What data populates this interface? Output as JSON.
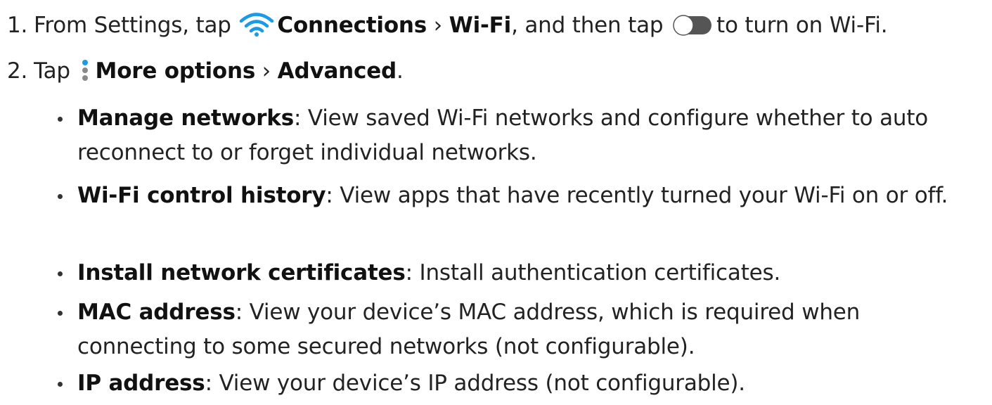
{
  "steps": [
    {
      "number": "1.",
      "part1": "From Settings, tap",
      "icon1": "wifi-icon",
      "bold1": "Connections",
      "sep1": " › ",
      "bold2": "Wi-Fi",
      "part2": ", and then tap",
      "icon2": "toggle-icon",
      "part3": "to turn on Wi-Fi."
    },
    {
      "number": "2.",
      "part1": "Tap",
      "icon1": "more-options-icon",
      "bold1": "More options",
      "sep1": " › ",
      "bold2": "Advanced",
      "part2": "."
    }
  ],
  "bullets": [
    {
      "term": "Manage networks",
      "desc": ": View saved Wi-Fi networks and configure whether to auto reconnect to or forget individual networks."
    },
    {
      "term": "Wi-Fi control history",
      "desc": ": View apps that have recently turned your Wi-Fi on or off."
    },
    {
      "term": "Install network certificates",
      "desc": ": Install authentication certificates."
    },
    {
      "term": "MAC address",
      "desc": ": View your device’s MAC address, which is required when connecting to some secured networks (not configurable)."
    },
    {
      "term": "IP address",
      "desc": ": View your device’s IP address (not configurable)."
    }
  ],
  "colors": {
    "icon_blue": "#1a9be6",
    "toggle_track": "#555555",
    "text": "#222222"
  }
}
